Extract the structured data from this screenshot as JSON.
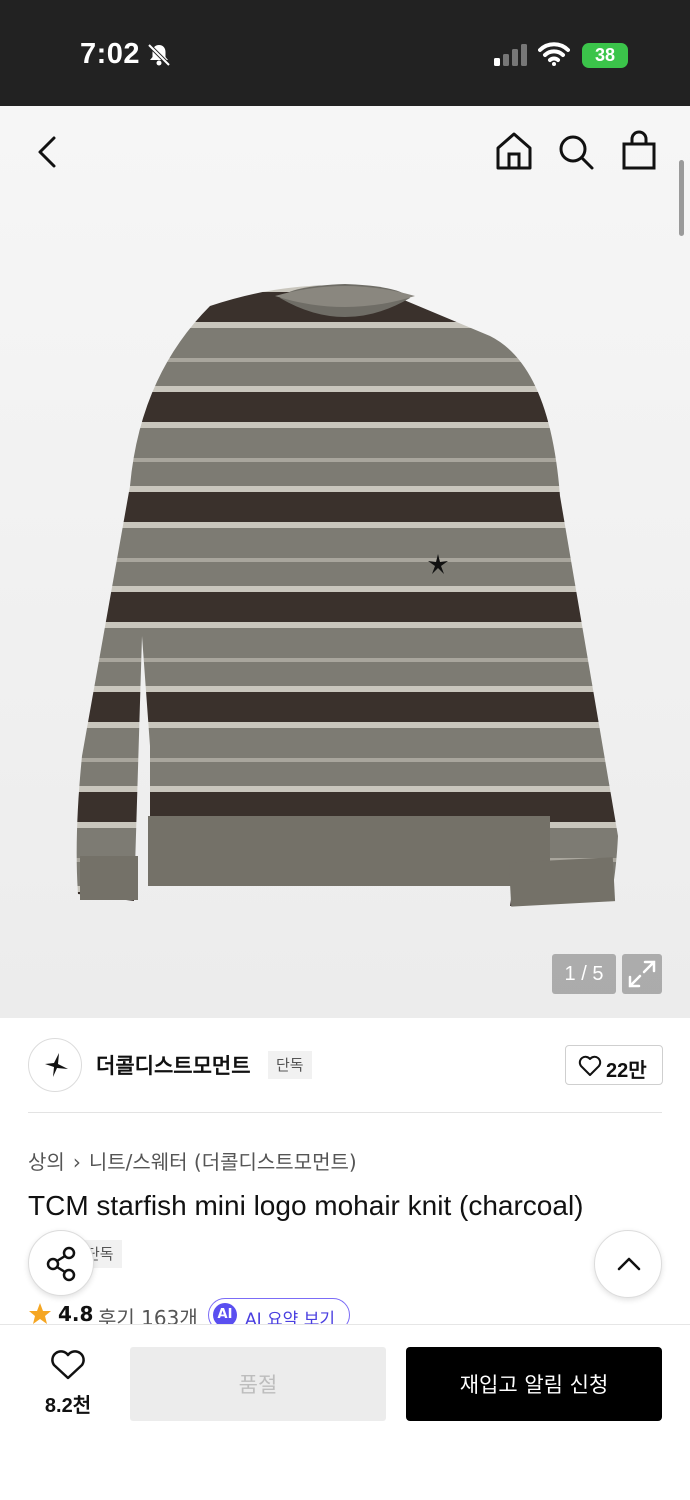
{
  "status_bar": {
    "time": "7:02",
    "battery": "38"
  },
  "gallery": {
    "counter": "1 / 5"
  },
  "brand": {
    "name": "더콜디스트모먼트",
    "badge": "단독",
    "likes": "22만"
  },
  "breadcrumb": {
    "category": "상의",
    "subcategory": "니트/스웨터 (더콜디스트모먼트)"
  },
  "product": {
    "title": "TCM starfish mini logo mohair knit (charcoal)",
    "badge": "단독",
    "rating": "4.8",
    "reviews": "후기 163개",
    "ai_summary": "AI 요약 보기",
    "ai_icon_text": "AI"
  },
  "bottom_bar": {
    "wish_count": "8.2천",
    "soldout_label": "품절",
    "restock_label": "재입고 알림 신청"
  },
  "colors": {
    "accent_purple": "#5a4ff0",
    "star": "#f5a623",
    "battery_green": "#3bc44a"
  },
  "icons": [
    "back-icon",
    "home-icon",
    "search-icon",
    "bag-icon",
    "expand-icon",
    "heart-icon",
    "share-icon",
    "chevron-up-icon",
    "star-icon",
    "starfish-logo-icon",
    "bell-slash-icon",
    "signal-icon",
    "wifi-icon"
  ]
}
